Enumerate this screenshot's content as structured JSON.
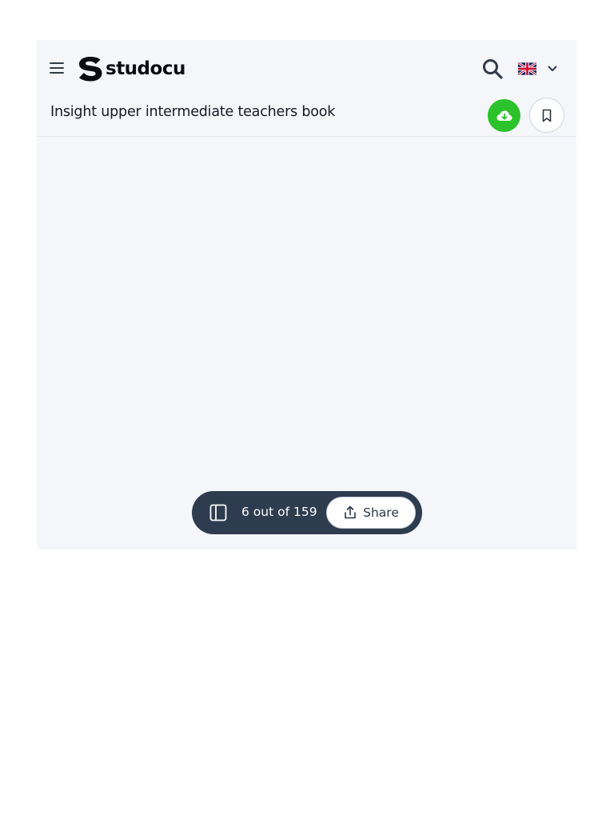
{
  "header": {
    "brand": "studocu",
    "menu_icon": "hamburger-menu-icon",
    "search_icon": "search-icon",
    "language_icon": "uk-flag-icon",
    "language_chevron": "chevron-down-icon"
  },
  "document": {
    "title": "Insight upper intermediate teachers book",
    "download_icon": "cloud-download-icon",
    "bookmark_icon": "bookmark-icon"
  },
  "pager": {
    "page_text": "6 out of 159",
    "share_label": "Share",
    "sidebar_icon": "sidebar-panel-icon",
    "share_icon": "share-upload-icon"
  },
  "colors": {
    "accent_green": "#2bc22b",
    "pager_background": "#2e3c4f",
    "viewer_background": "#f4f6fa"
  }
}
